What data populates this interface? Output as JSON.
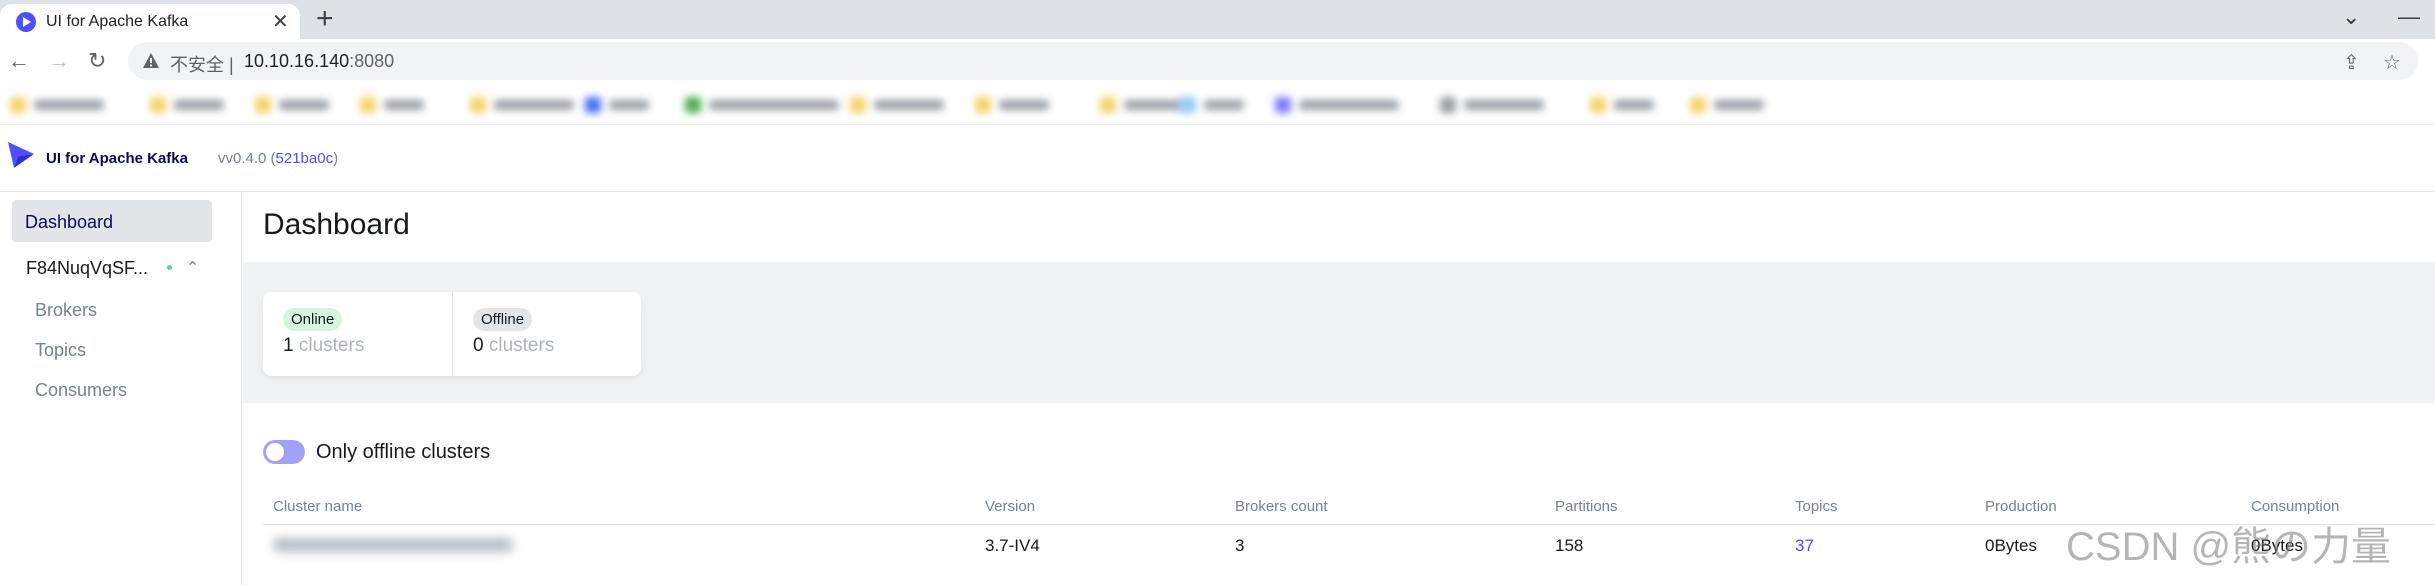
{
  "browser": {
    "tab_title": "UI for Apache Kafka",
    "new_tab_glyph": "+",
    "close_glyph": "✕",
    "security_label": "不安全",
    "url_host": "10.10.16.140",
    "url_port": ":8080",
    "minimize_glyph": "—",
    "expand_glyph": "⌄"
  },
  "app": {
    "name": "UI for Apache Kafka",
    "version_prefix": "vv0.4.0 (",
    "version_commit": "521ba0c",
    "version_suffix": ")",
    "brand_color": "#4f4ffe"
  },
  "sidebar": {
    "dashboard": "Dashboard",
    "cluster_name": "F84NuqVqSF...",
    "cluster_status_color": "#5cd685",
    "items": [
      "Brokers",
      "Topics",
      "Consumers"
    ]
  },
  "main": {
    "title": "Dashboard",
    "metrics": [
      {
        "tag": "Online",
        "value": "1",
        "unit": "clusters"
      },
      {
        "tag": "Offline",
        "value": "0",
        "unit": "clusters"
      }
    ],
    "toggle_label": "Only offline clusters",
    "toggle_on": false,
    "table": {
      "headers": [
        "Cluster name",
        "Version",
        "Brokers count",
        "Partitions",
        "Topics",
        "Production",
        "Consumption"
      ],
      "rows": [
        {
          "version": "3.7-IV4",
          "brokers": "3",
          "partitions": "158",
          "topics": "37",
          "production": "0Bytes",
          "consumption": "0Bytes"
        }
      ]
    }
  },
  "watermark": "CSDN @熊の力量"
}
